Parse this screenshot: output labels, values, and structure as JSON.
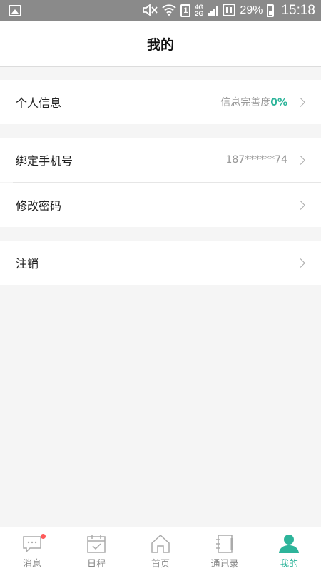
{
  "status_bar": {
    "network_4g": "4G",
    "network_2g": "2G",
    "sim": "1",
    "battery": "29%",
    "time": "15:18"
  },
  "header": {
    "title": "我的"
  },
  "rows": {
    "personal_info": {
      "label": "个人信息",
      "value_prefix": "信息完善度",
      "value_accent": "0%"
    },
    "bind_phone": {
      "label": "绑定手机号",
      "value": "187******74"
    },
    "change_password": {
      "label": "修改密码"
    },
    "logout": {
      "label": "注销"
    }
  },
  "accent_color": "#2db49a",
  "tabs": [
    {
      "label": "消息",
      "icon": "message-icon",
      "badge": true
    },
    {
      "label": "日程",
      "icon": "calendar-icon"
    },
    {
      "label": "首页",
      "icon": "home-icon"
    },
    {
      "label": "通讯录",
      "icon": "contacts-icon"
    },
    {
      "label": "我的",
      "icon": "profile-icon",
      "active": true
    }
  ]
}
